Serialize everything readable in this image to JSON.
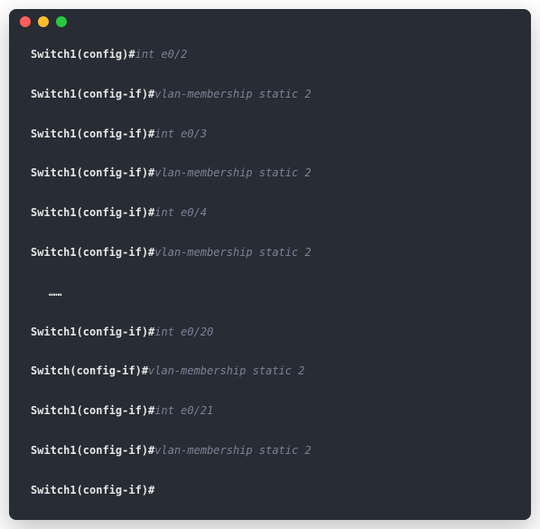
{
  "lines": [
    {
      "prompt": "Switch1(config)#",
      "command": "int e0/2"
    },
    {
      "prompt": "Switch1(config-if)#",
      "command": "vlan-membership static 2"
    },
    {
      "prompt": "Switch1(config-if)#",
      "command": "int e0/3"
    },
    {
      "prompt": "Switch1(config-if)#",
      "command": "vlan-membership static 2"
    },
    {
      "prompt": "Switch1(config-if)#",
      "command": "int e0/4"
    },
    {
      "prompt": "Switch1(config-if)#",
      "command": "vlan-membership static 2"
    },
    {
      "ellipsis": "……"
    },
    {
      "prompt": "Switch1(config-if)#",
      "command": "int e0/20"
    },
    {
      "prompt": "Switch(config-if)#",
      "command": "vlan-membership static 2"
    },
    {
      "prompt": "Switch1(config-if)#",
      "command": "int e0/21"
    },
    {
      "prompt": "Switch1(config-if)#",
      "command": "vlan-membership static 2"
    },
    {
      "prompt": "Switch1(config-if)#",
      "command": ""
    }
  ]
}
